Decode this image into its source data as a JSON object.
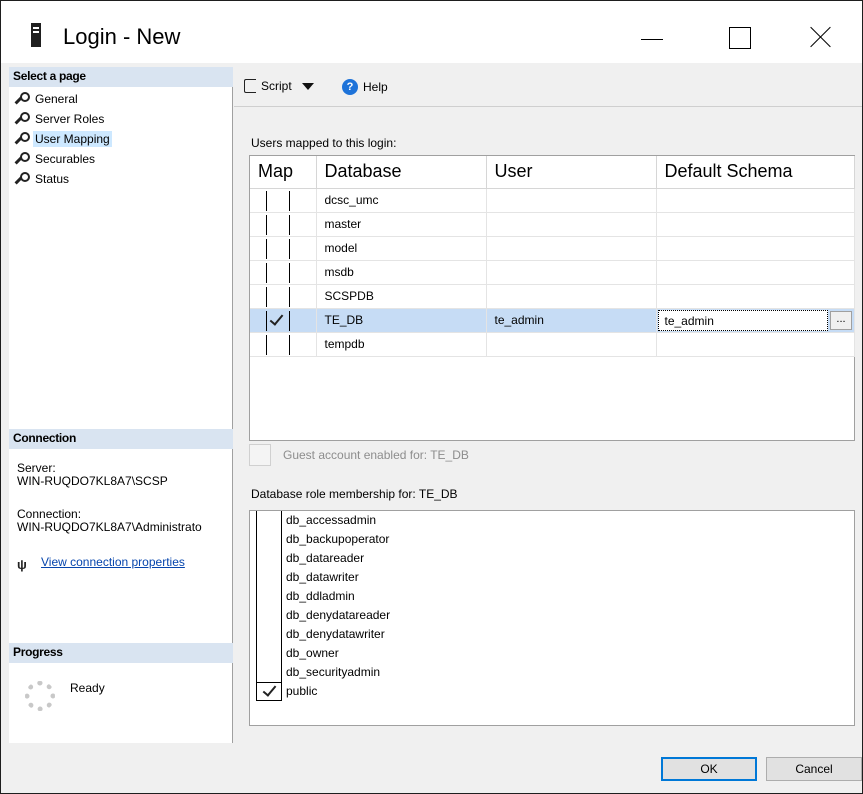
{
  "window": {
    "title": "Login - New"
  },
  "left": {
    "select_page_header": "Select a page",
    "pages": [
      {
        "label": "General"
      },
      {
        "label": "Server Roles"
      },
      {
        "label": "User Mapping"
      },
      {
        "label": "Securables"
      },
      {
        "label": "Status"
      }
    ],
    "connection_header": "Connection",
    "server_label": "Server:",
    "server_value": "WIN-RUQDO7KL8A7\\SCSP",
    "connection_label": "Connection:",
    "connection_value": "WIN-RUQDO7KL8A7\\Administrato",
    "view_props_link": "View connection properties",
    "progress_header": "Progress",
    "progress_status": "Ready"
  },
  "toolbar": {
    "script_label": "Script",
    "help_label": "Help"
  },
  "users": {
    "label": "Users mapped to this login:",
    "columns": [
      "Map",
      "Database",
      "User",
      "Default Schema"
    ],
    "rows": [
      {
        "mapped": false,
        "database": "dcsc_umc",
        "user": "",
        "schema": ""
      },
      {
        "mapped": false,
        "database": "master",
        "user": "",
        "schema": ""
      },
      {
        "mapped": false,
        "database": "model",
        "user": "",
        "schema": ""
      },
      {
        "mapped": false,
        "database": "msdb",
        "user": "",
        "schema": ""
      },
      {
        "mapped": false,
        "database": "SCSPDB",
        "user": "",
        "schema": ""
      },
      {
        "mapped": true,
        "database": "TE_DB",
        "user": "te_admin",
        "schema": "te_admin"
      },
      {
        "mapped": false,
        "database": "tempdb",
        "user": "",
        "schema": ""
      }
    ],
    "ellipsis": "..."
  },
  "guest": {
    "label": "Guest account enabled for: TE_DB"
  },
  "roles": {
    "label": "Database role membership for: TE_DB",
    "items": [
      {
        "name": "db_accessadmin",
        "checked": false
      },
      {
        "name": "db_backupoperator",
        "checked": false
      },
      {
        "name": "db_datareader",
        "checked": false
      },
      {
        "name": "db_datawriter",
        "checked": false
      },
      {
        "name": "db_ddladmin",
        "checked": false
      },
      {
        "name": "db_denydatareader",
        "checked": false
      },
      {
        "name": "db_denydatawriter",
        "checked": false
      },
      {
        "name": "db_owner",
        "checked": false
      },
      {
        "name": "db_securityadmin",
        "checked": false
      },
      {
        "name": "public",
        "checked": true
      }
    ]
  },
  "footer": {
    "ok_label": "OK",
    "cancel_label": "Cancel"
  }
}
